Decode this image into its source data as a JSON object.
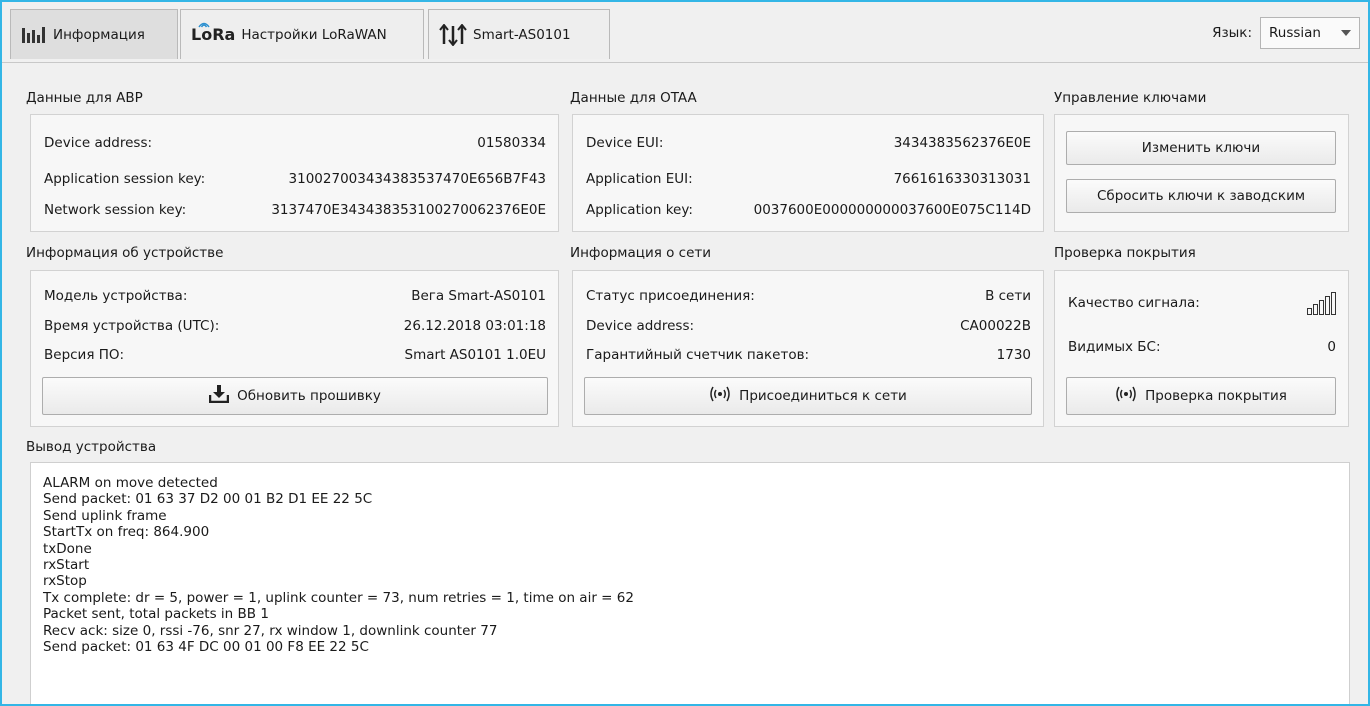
{
  "tabs": [
    {
      "label": "Информация",
      "icon": "bar-chart-icon"
    },
    {
      "label": "Настройки LoRaWAN",
      "icon": "lora-logo-icon",
      "logo_text": "LoRa"
    },
    {
      "label": "Smart-AS0101",
      "icon": "sliders-icon"
    }
  ],
  "language": {
    "label": "Язык:",
    "value": "Russian"
  },
  "abp": {
    "title": "Данные для ABP",
    "rows": [
      {
        "label": "Device address:",
        "value": "01580334"
      },
      {
        "label": "Application session key:",
        "value": "310027003434383537470E656B7F43"
      },
      {
        "label": "Network session key:",
        "value": "3137470E343438353100270062376E0E"
      }
    ]
  },
  "otaa": {
    "title": "Данные для OTAA",
    "rows": [
      {
        "label": "Device EUI:",
        "value": "3434383562376E0E"
      },
      {
        "label": "Application EUI:",
        "value": "7661616330313031"
      },
      {
        "label": "Application key:",
        "value": "0037600E000000000037600E075C114D"
      }
    ]
  },
  "keys": {
    "title": "Управление ключами",
    "change_label": "Изменить ключи",
    "reset_label": "Сбросить ключи к заводским"
  },
  "device_info": {
    "title": "Информация об устройстве",
    "rows": [
      {
        "label": "Модель устройства:",
        "value": "Вега Smart-AS0101"
      },
      {
        "label": "Время устройства (UTC):",
        "value": "26.12.2018 03:01:18"
      },
      {
        "label": "Версия ПО:",
        "value": "Smart AS0101 1.0EU"
      }
    ],
    "update_label": "Обновить прошивку"
  },
  "network_info": {
    "title": "Информация о сети",
    "rows": [
      {
        "label": "Статус присоединения:",
        "value": "В сети"
      },
      {
        "label": "Device address:",
        "value": "CA00022B"
      },
      {
        "label": "Гарантийный счетчик пакетов:",
        "value": "1730"
      }
    ],
    "join_label": "Присоединиться к сети"
  },
  "coverage": {
    "title": "Проверка покрытия",
    "signal_label": "Качество сигнала:",
    "signal_bars_total": 5,
    "visible_bs_label": "Видимых БС:",
    "visible_bs_value": "0",
    "check_label": "Проверка покрытия"
  },
  "output": {
    "title": "Вывод устройства",
    "lines": [
      "ALARM on move detected",
      "Send packet: 01 63 37 D2 00 01 B2 D1 EE 22 5C",
      "Send uplink frame",
      "StartTx on freq: 864.900",
      "txDone",
      "rxStart",
      "rxStop",
      "Tx complete: dr = 5, power = 1, uplink counter = 73, num retries = 1, time on air = 62",
      "Packet sent, total packets in BB 1",
      "Recv ack: size 0, rssi -76, snr 27, rx window 1, downlink counter 77",
      "Send packet: 01 63 4F DC 00 01 00 F8 EE 22 5C"
    ]
  }
}
